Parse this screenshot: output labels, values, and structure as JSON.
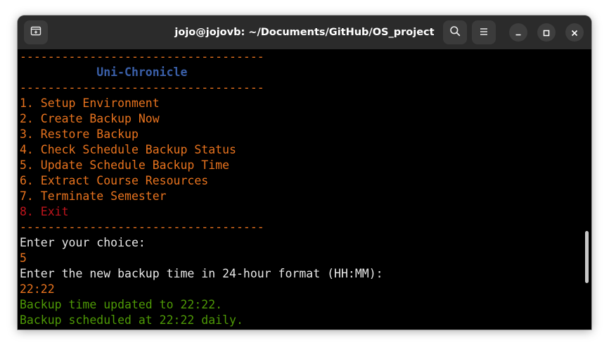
{
  "window": {
    "title": "jojo@jojovb: ~/Documents/GitHub/OS_project"
  },
  "terminal": {
    "lines": [
      {
        "text": "-----------------------------------",
        "color": "orange"
      },
      {
        "text": "           Uni-Chronicle",
        "color": "blue"
      },
      {
        "text": "-----------------------------------",
        "color": "orange"
      },
      {
        "text": "1. Setup Environment",
        "color": "orange"
      },
      {
        "text": "2. Create Backup Now",
        "color": "orange"
      },
      {
        "text": "3. Restore Backup",
        "color": "orange"
      },
      {
        "text": "4. Check Schedule Backup Status",
        "color": "orange"
      },
      {
        "text": "5. Update Schedule Backup Time",
        "color": "orange"
      },
      {
        "text": "6. Extract Course Resources",
        "color": "orange"
      },
      {
        "text": "7. Terminate Semester",
        "color": "orange"
      },
      {
        "text": "8. Exit",
        "color": "red"
      },
      {
        "text": "-----------------------------------",
        "color": "orange"
      },
      {
        "text": "Enter your choice:",
        "color": "white"
      },
      {
        "text": "5",
        "color": "orange"
      },
      {
        "text": "Enter the new backup time in 24-hour format (HH:MM):",
        "color": "white"
      },
      {
        "text": "22:22",
        "color": "orange"
      },
      {
        "text": "Backup time updated to 22:22.",
        "color": "green"
      },
      {
        "text": "Backup scheduled at 22:22 daily.",
        "color": "green"
      }
    ]
  },
  "colors": {
    "orange": "#e8731e",
    "red": "#c0141c",
    "white": "#e8e8e8",
    "green": "#4e9a06",
    "blue": "#3a5fa8",
    "titlebar": "#2b2b2b"
  },
  "icons": {
    "new_tab": "new-tab-icon",
    "search": "search-icon",
    "menu": "hamburger-menu-icon",
    "minimize": "minimize-icon",
    "maximize": "maximize-icon",
    "close": "close-icon"
  }
}
